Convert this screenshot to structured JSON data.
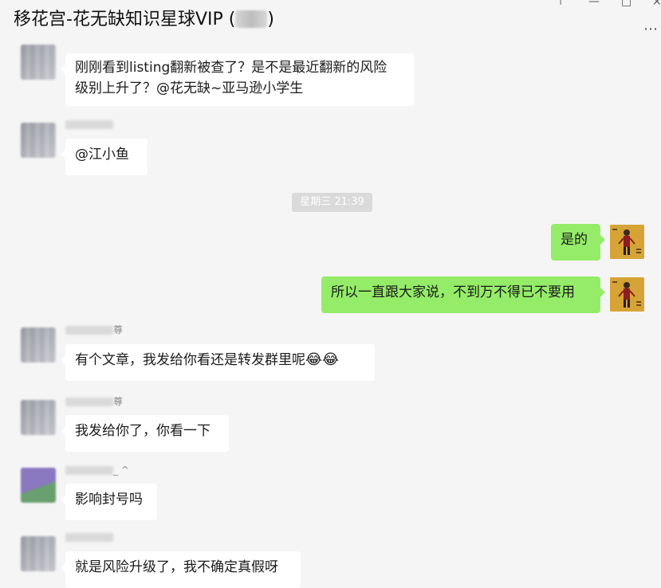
{
  "window": {
    "title": "移花宫-花无缺知识星球VIP (",
    "title_suffix": ")",
    "minimize_icon": "minimize-icon",
    "maximize_icon": "maximize-icon",
    "close_icon": "close-icon"
  },
  "chat": {
    "time_separator": "星期三 21:39",
    "messages": [
      {
        "side": "left",
        "text_line1": "刚刚看到listing翻新被查了？是不是最近翻新的风险",
        "text_line2": "级别上升了？@花无缺~亚马逊小学生"
      },
      {
        "side": "left",
        "nick_suffix": "",
        "text": "@江小鱼"
      },
      {
        "side": "right",
        "text": "是的"
      },
      {
        "side": "right",
        "text": "所以一直跟大家说，不到万不得已不要用"
      },
      {
        "side": "left",
        "nick_suffix": "尊",
        "text": "有个文章，我发给你看还是转发群里呢",
        "emoji": "😂😂"
      },
      {
        "side": "left",
        "nick_suffix": "尊",
        "text": "我发给你了，你看一下"
      },
      {
        "side": "left",
        "nick_suffix": "_ ^",
        "text": "影响封号吗"
      },
      {
        "side": "left",
        "nick_suffix": "",
        "text": "就是风险升级了，我不确定真假呀"
      }
    ]
  },
  "colors": {
    "background": "#f5f5f5",
    "bubble_left": "#ffffff",
    "bubble_me": "#95ec69",
    "my_avatar": "#d6a436"
  }
}
